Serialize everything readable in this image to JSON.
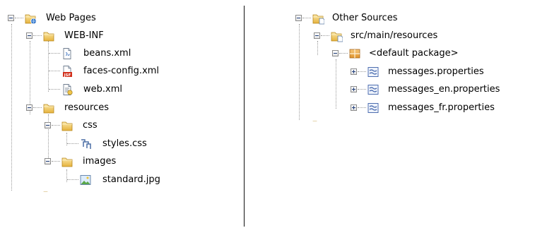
{
  "left_tree": {
    "web_pages": "Web Pages",
    "web_inf": "WEB-INF",
    "beans_xml": "beans.xml",
    "faces_config_xml": "faces-config.xml",
    "web_xml": "web.xml",
    "resources": "resources",
    "css": "css",
    "styles_css": "styles.css",
    "images": "images",
    "standard_jpg": "standard.jpg"
  },
  "right_tree": {
    "other_sources": "Other Sources",
    "src_main_resources": "src/main/resources",
    "default_package": "<default package>",
    "messages_properties": "messages.properties",
    "messages_en_properties": "messages_en.properties",
    "messages_fr_properties": "messages_fr.properties"
  },
  "icons": {
    "folder": "folder-icon",
    "web_pages_folder": "web-pages-folder-icon",
    "source_folder": "source-folder-icon",
    "package": "package-icon",
    "xml_file": "xml-file-icon",
    "jsf_file": "jsf-config-file-icon",
    "web_xml_file": "web-xml-file-icon",
    "css_file": "css-file-icon",
    "image_file": "image-file-icon",
    "properties_file": "properties-file-icon"
  },
  "colors": {
    "folder_light": "#f6d77c",
    "folder_dark": "#d9a521",
    "tree_lines": "#9a9a9a",
    "jsf_badge": "#d2301c",
    "package_orange": "#e0932a",
    "properties_blue": "#3b5fa8"
  }
}
